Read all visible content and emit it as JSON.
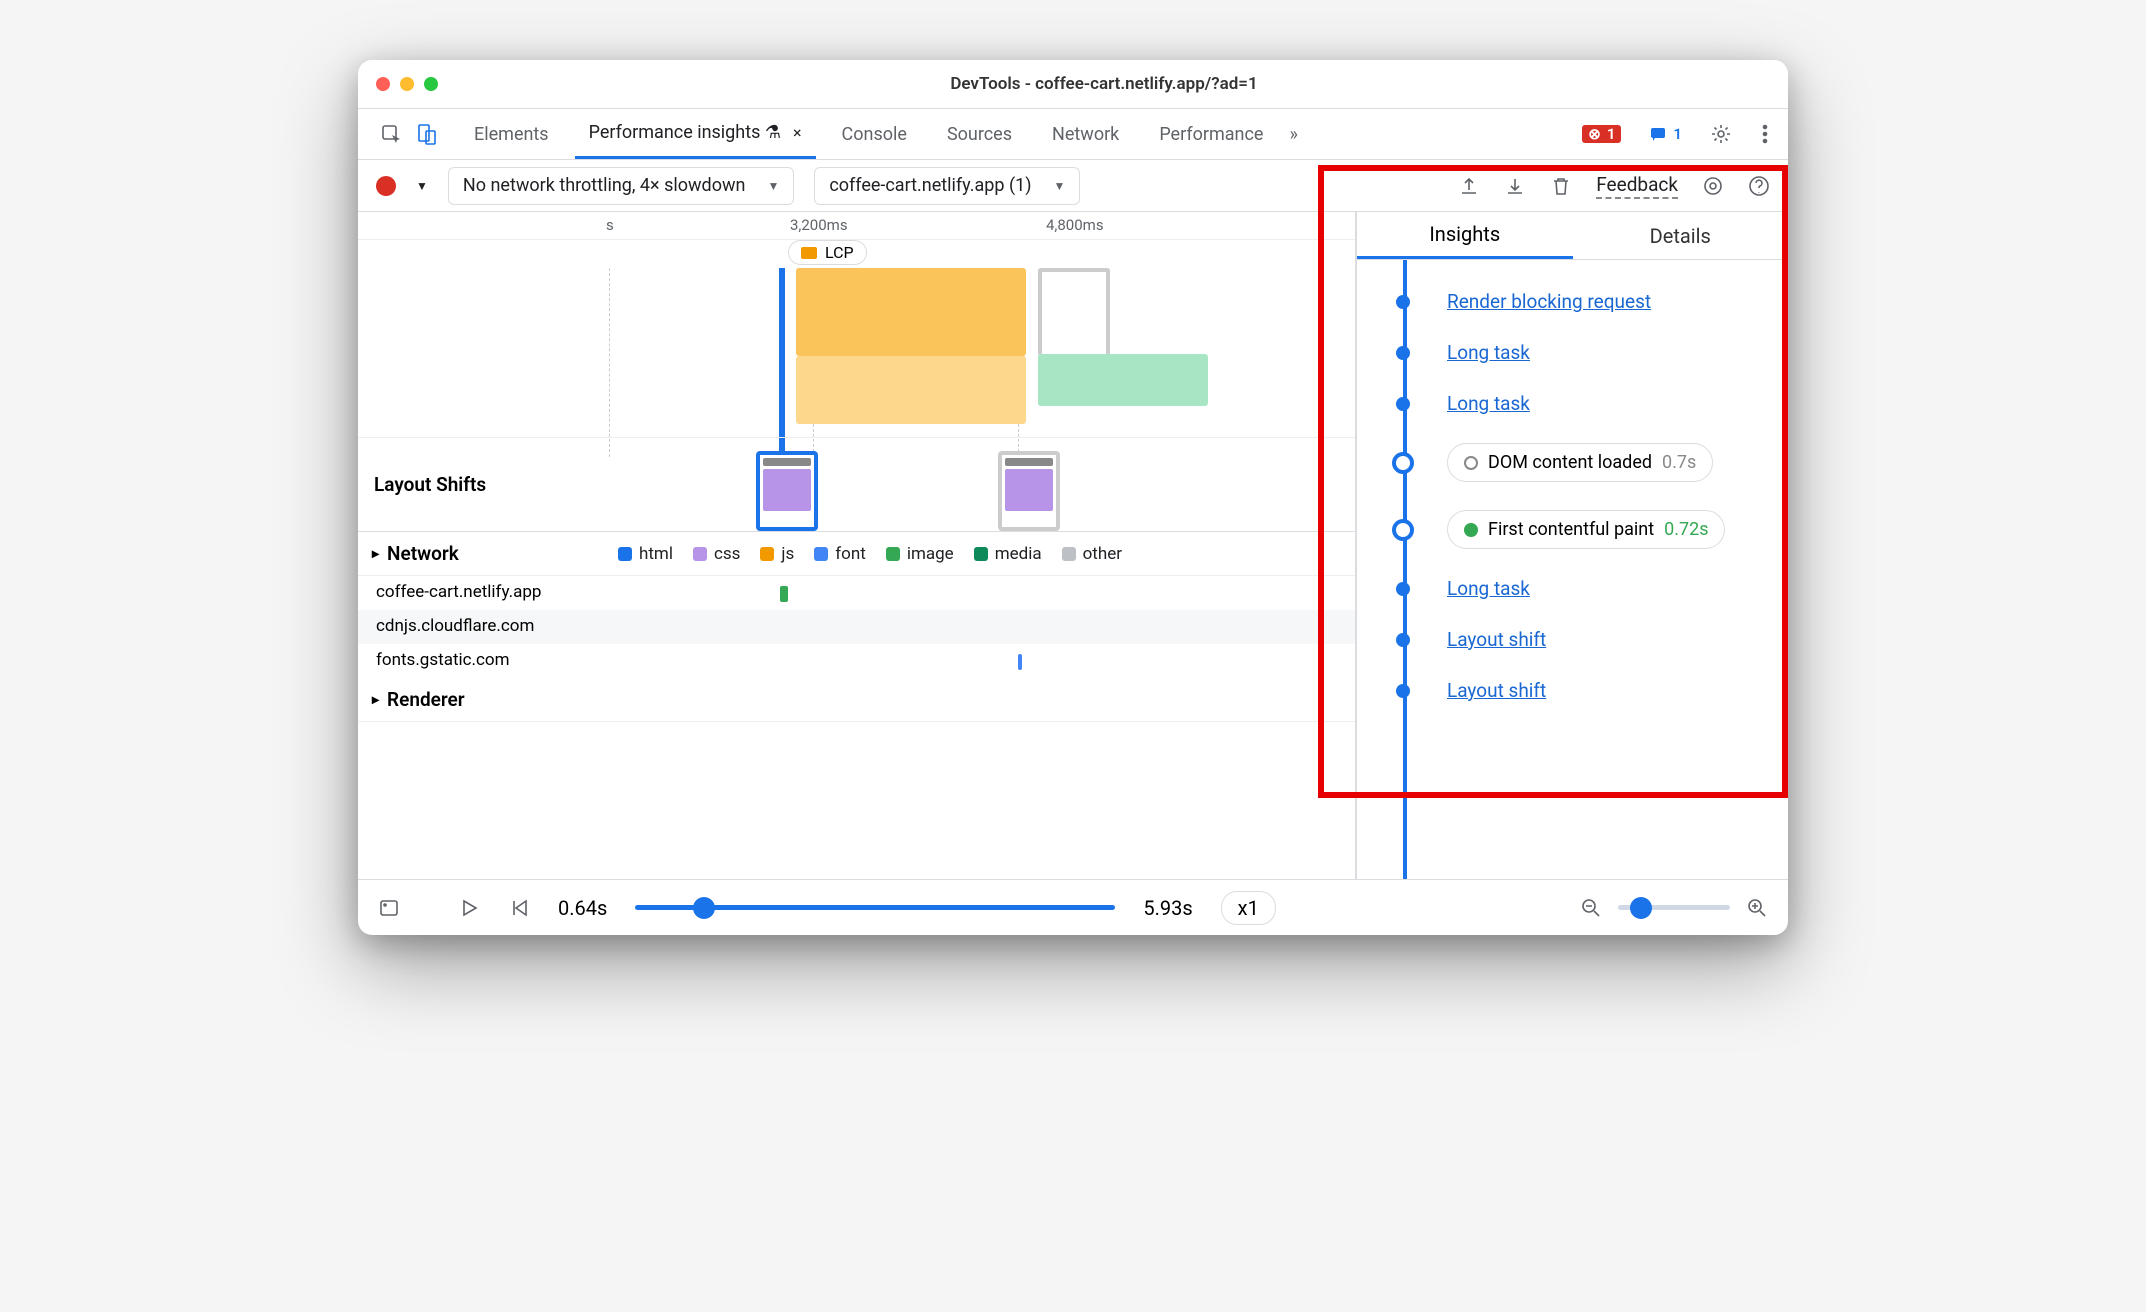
{
  "window_title": "DevTools - coffee-cart.netlify.app/?ad=1",
  "top_tabs": {
    "elements": "Elements",
    "perf_insights": "Performance insights ⚗",
    "console": "Console",
    "sources": "Sources",
    "network": "Network",
    "performance": "Performance",
    "overflow": "»"
  },
  "status_badges": {
    "errors": "1",
    "messages": "1"
  },
  "subtoolbar": {
    "throttling": "No network throttling, 4× slowdown",
    "target": "coffee-cart.netlify.app (1)",
    "feedback": "Feedback"
  },
  "timeline": {
    "tick1_label": "s",
    "tick2_label": "3,200ms",
    "tick3_label": "4,800ms",
    "lcp_label": "LCP",
    "layout_shifts_label": "Layout Shifts"
  },
  "network_section": {
    "title": "Network",
    "legend": {
      "html": "html",
      "css": "css",
      "js": "js",
      "font": "font",
      "image": "image",
      "media": "media",
      "other": "other"
    },
    "hosts": [
      "coffee-cart.netlify.app",
      "cdnjs.cloudflare.com",
      "fonts.gstatic.com"
    ]
  },
  "renderer_section": {
    "title": "Renderer"
  },
  "right_panel": {
    "tabs": {
      "insights": "Insights",
      "details": "Details"
    },
    "items": [
      {
        "type": "link",
        "label": "Render blocking request"
      },
      {
        "type": "link",
        "label": "Long task"
      },
      {
        "type": "link",
        "label": "Long task"
      },
      {
        "type": "pill",
        "dot": "gray",
        "label": "DOM content loaded",
        "value": "0.7s",
        "valClass": "t-gray"
      },
      {
        "type": "pill",
        "dot": "green",
        "label": "First contentful paint",
        "value": "0.72s",
        "valClass": "t-green"
      },
      {
        "type": "link",
        "label": "Long task"
      },
      {
        "type": "link",
        "label": "Layout shift"
      },
      {
        "type": "link",
        "label": "Layout shift"
      }
    ]
  },
  "bottom_bar": {
    "start_time": "0.64s",
    "end_time": "5.93s",
    "zoom_level": "x1"
  },
  "colors": {
    "html": "#1a73e8",
    "css": "#b794e8",
    "js": "#f29900",
    "font": "#4285f4",
    "image": "#34a853",
    "media": "#0d8a5a",
    "other": "#bdc1c6"
  }
}
